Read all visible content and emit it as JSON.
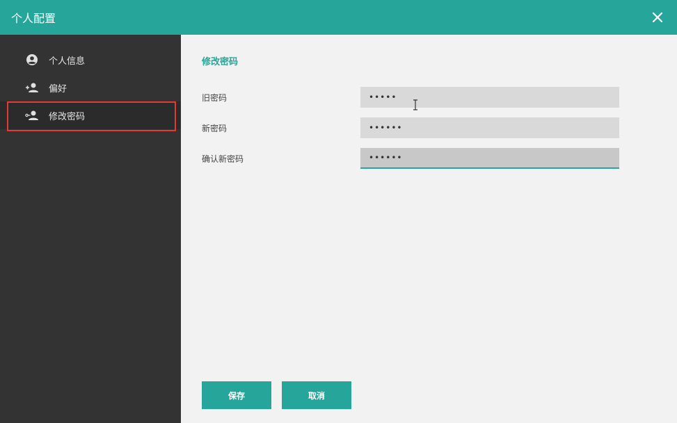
{
  "window": {
    "title": "个人配置"
  },
  "sidebar": {
    "items": [
      {
        "label": "个人信息",
        "icon": "account-circle-icon"
      },
      {
        "label": "偏好",
        "icon": "person-add-icon"
      },
      {
        "label": "修改密码",
        "icon": "person-key-icon"
      }
    ]
  },
  "main": {
    "section_title": "修改密码",
    "fields": [
      {
        "label": "旧密码",
        "value": "•••••"
      },
      {
        "label": "新密码",
        "value": "••••••"
      },
      {
        "label": "确认新密码",
        "value": "••••••"
      }
    ],
    "buttons": {
      "save": "保存",
      "cancel": "取消"
    }
  },
  "colors": {
    "accent": "#26a69a",
    "sidebar_bg": "#333333",
    "highlight": "#e53935"
  }
}
